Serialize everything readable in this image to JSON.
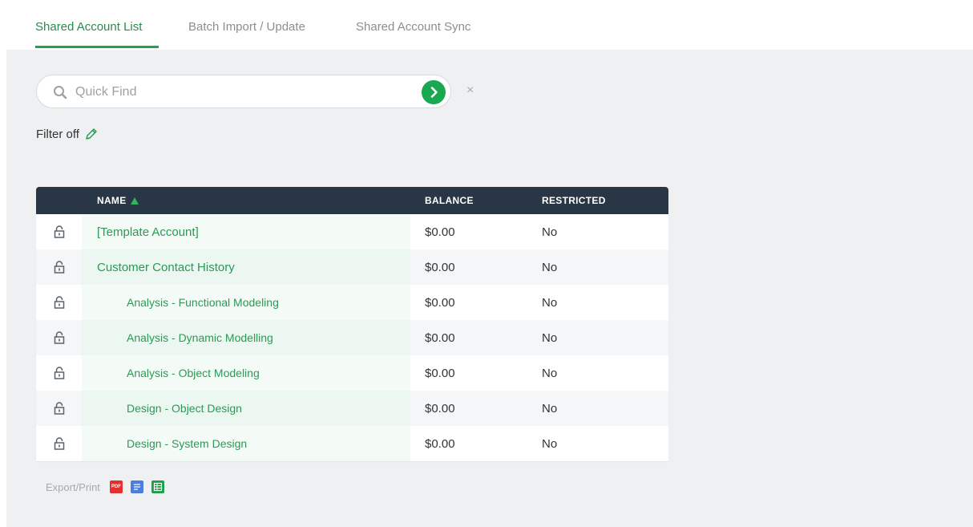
{
  "tabs": [
    {
      "label": "Shared Account List",
      "active": true
    },
    {
      "label": "Batch Import / Update",
      "active": false
    },
    {
      "label": "Shared Account Sync",
      "active": false
    }
  ],
  "search": {
    "placeholder": "Quick Find",
    "value": "",
    "clear_label": "×"
  },
  "filter": {
    "label": "Filter off"
  },
  "table": {
    "columns": {
      "name": "NAME",
      "balance": "BALANCE",
      "restricted": "RESTRICTED"
    },
    "sort": {
      "column": "name",
      "direction": "ascending"
    },
    "rows": [
      {
        "name": "[Template Account]",
        "balance": "$0.00",
        "restricted": "No",
        "level": 0
      },
      {
        "name": "Customer Contact History",
        "balance": "$0.00",
        "restricted": "No",
        "level": 0
      },
      {
        "name": "Analysis - Functional Modeling",
        "balance": "$0.00",
        "restricted": "No",
        "level": 1
      },
      {
        "name": "Analysis - Dynamic Modelling",
        "balance": "$0.00",
        "restricted": "No",
        "level": 1
      },
      {
        "name": "Analysis - Object Modeling",
        "balance": "$0.00",
        "restricted": "No",
        "level": 1
      },
      {
        "name": "Design - Object Design",
        "balance": "$0.00",
        "restricted": "No",
        "level": 1
      },
      {
        "name": "Design - System Design",
        "balance": "$0.00",
        "restricted": "No",
        "level": 1
      }
    ]
  },
  "export": {
    "label": "Export/Print",
    "pdf_text": "PDF",
    "icons": [
      "pdf-icon",
      "document-icon",
      "spreadsheet-icon"
    ]
  },
  "colors": {
    "accent": "#1ea64f",
    "link": "#2a9a54",
    "header_bg": "#283645",
    "content_bg": "#eef0f1"
  }
}
